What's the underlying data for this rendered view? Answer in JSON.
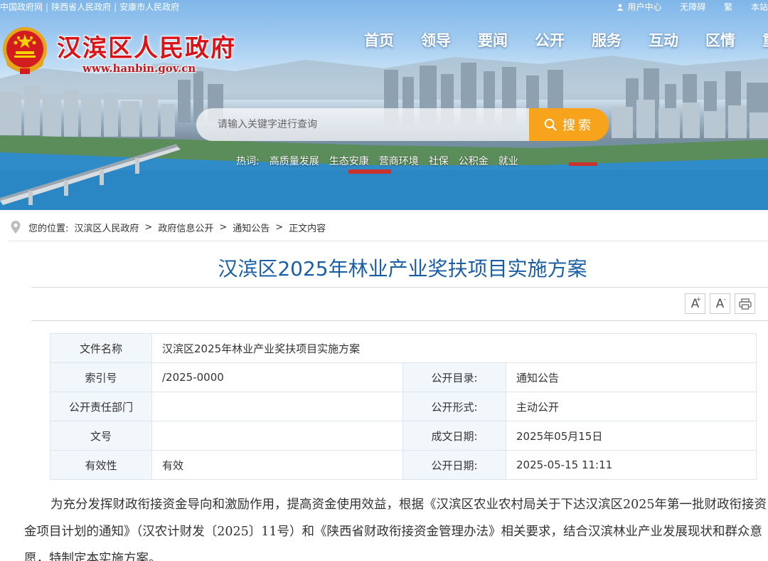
{
  "topbar": {
    "links": [
      "中国政府网",
      "陕西省人民政府",
      "安康市人民政府"
    ],
    "right": [
      "用户中心",
      "无障碍",
      "繁",
      "本站"
    ]
  },
  "site": {
    "title": "汉滨区人民政府",
    "url": "www.hanbin.gov.cn"
  },
  "nav": [
    "首页",
    "领导",
    "要闻",
    "公开",
    "服务",
    "互动",
    "区情",
    "重"
  ],
  "search": {
    "placeholder": "请输入关键字进行查询",
    "button": "搜索"
  },
  "hot": {
    "label": "热词:",
    "words": [
      "高质量发展",
      "生态安康",
      "营商环境",
      "社保",
      "公积金",
      "就业"
    ]
  },
  "breadcrumb": {
    "prefix": "您的位置:",
    "items": [
      "汉滨区人民政府",
      ">",
      "政府信息公开",
      ">",
      "通知公告",
      ">",
      "正文内容"
    ]
  },
  "article": {
    "title": "汉滨区2025年林业产业奖扶项目实施方案",
    "tools": {
      "enlarge": "A",
      "shrink": "A"
    }
  },
  "meta": {
    "file_name_label": "文件名称",
    "file_name": "汉滨区2025年林业产业奖扶项目实施方案",
    "index_label": "索引号",
    "index": "/2025-0000",
    "catalog_label": "公开目录:",
    "catalog": "通知公告",
    "dept_label": "公开责任部门",
    "dept": "",
    "form_label": "公开形式:",
    "form": "主动公开",
    "doc_no_label": "文号",
    "doc_no": "",
    "written_label": "成文日期:",
    "written": "2025年05月15日",
    "validity_label": "有效性",
    "validity": "有效",
    "publish_label": "公开日期:",
    "publish": "2025-05-15 11:11"
  },
  "body": {
    "p1": "为充分发挥财政衔接资金导向和激励作用，提高资金使用效益，根据《汉滨区农业农村局关于下达汉滨区2025年第一批财政衔接资金项目计划的通知》（汉农计财发〔2025〕11号）和《陕西省财政衔接资金管理办法》相关要求，结合汉滨林业产业发展现状和群众意愿，特制定本实施方案。"
  }
}
